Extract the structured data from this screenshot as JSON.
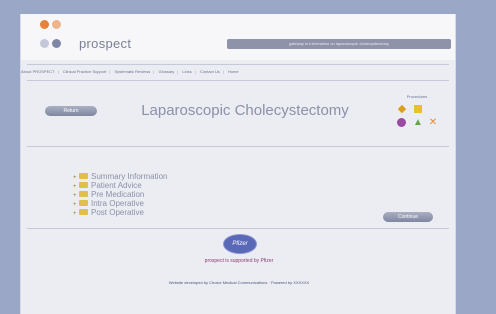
{
  "brand": {
    "name": "prospect",
    "tagline": "gateway to information on laparoscopic cholecystectomy"
  },
  "nav": {
    "items": [
      "About PROSPECT",
      "Clinical Practice Support",
      "Systematic Reviews",
      "Glossary",
      "Links",
      "Contact Us",
      "Home"
    ]
  },
  "page": {
    "title": "Laparoscopic Cholecystectomy",
    "back_label": "Return",
    "continue_label": "Continue"
  },
  "tools": {
    "label": "Procedures",
    "icons": [
      "diamond-icon",
      "square-icon",
      "circle-icon",
      "triangle-icon",
      "cross-icon"
    ]
  },
  "tree": {
    "items": [
      "Summary Information",
      "Patient Advice",
      "Pre Medication",
      "Intra Operative",
      "Post Operative"
    ]
  },
  "sponsor": {
    "logo_text": "Pfizer",
    "line": "prospect is supported by Pfizer"
  },
  "footer": {
    "text": "Website developed by Choice Medical Communications · Powered by XXXXXX"
  },
  "colors": {
    "frame": "#9aa7c6",
    "page": "#ecedf3",
    "accent": "#8e93aa",
    "dot_orange": "#e7823a",
    "dot_gray": "#7d86a6"
  }
}
